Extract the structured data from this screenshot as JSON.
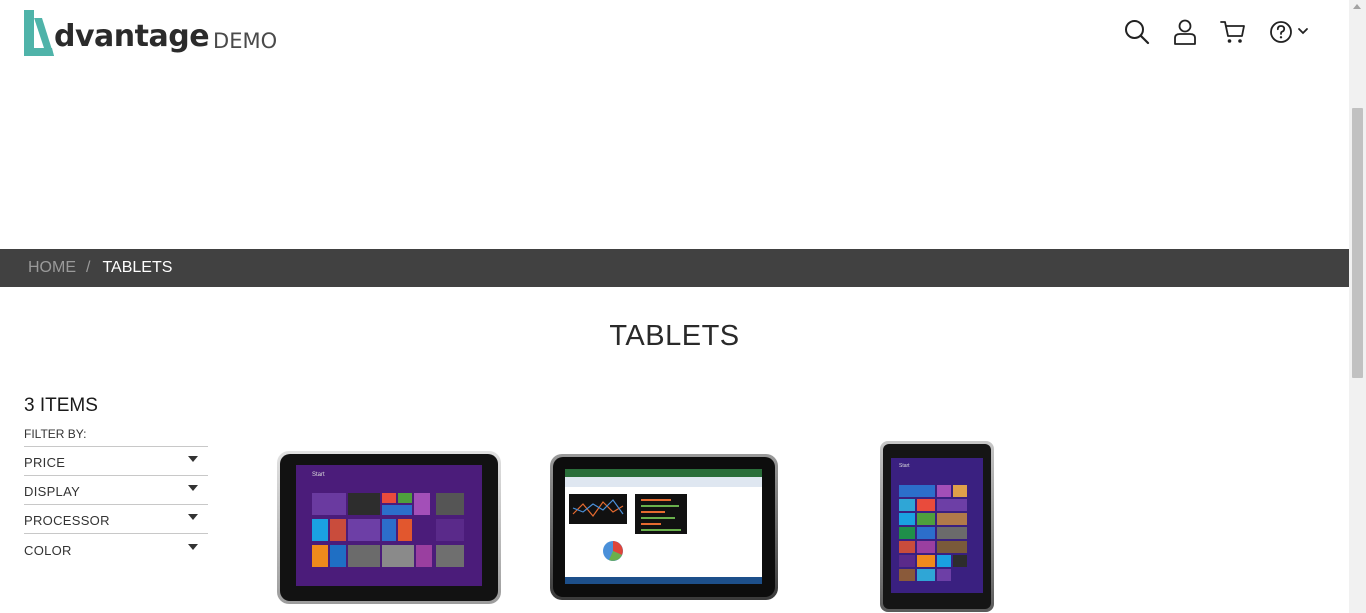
{
  "header": {
    "logo_word": "dvantage",
    "logo_suffix": "DEMO",
    "icons": [
      "search-icon",
      "user-icon",
      "cart-icon",
      "help-icon",
      "chevron-down-icon"
    ]
  },
  "breadcrumb": {
    "home": "HOME",
    "separator": "/",
    "current": "TABLETS"
  },
  "page_title": "TABLETS",
  "sidebar": {
    "item_count": "3 ITEMS",
    "filter_by": "FILTER BY:",
    "filters": [
      {
        "label": "PRICE"
      },
      {
        "label": "DISPLAY"
      },
      {
        "label": "PROCESSOR"
      },
      {
        "label": "COLOR"
      }
    ]
  },
  "colors": {
    "brand_teal": "#4fb3a9",
    "breadcrumb_bg": "#414141",
    "win_purple": "#4b1c7a"
  }
}
